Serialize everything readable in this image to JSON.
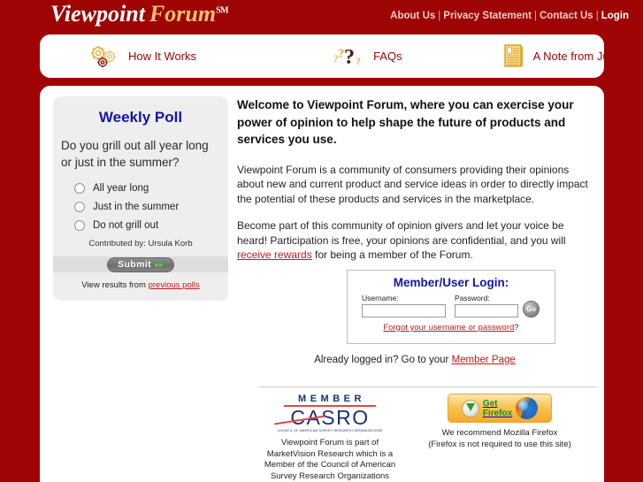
{
  "brand": {
    "name_part1": "Viewpoint",
    "name_part2": "Forum",
    "sm": "SM"
  },
  "topnav": {
    "items": [
      {
        "label": "About Us"
      },
      {
        "label": "Privacy Statement"
      },
      {
        "label": "Contact Us"
      },
      {
        "label": "Login"
      }
    ],
    "separator": "|"
  },
  "navbar": {
    "items": [
      {
        "label": "How It Works",
        "icon": "gears-icon"
      },
      {
        "label": "FAQs",
        "icon": "question-marks-icon"
      },
      {
        "label": "A Note from Julie",
        "icon": "document-icon"
      }
    ]
  },
  "poll": {
    "title": "Weekly Poll",
    "question": "Do you grill out all year long or just in the summer?",
    "options": [
      {
        "label": "All year long"
      },
      {
        "label": "Just in the summer"
      },
      {
        "label": "Do not grill out"
      }
    ],
    "contributed_by": "Contributed by: Ursula Korb",
    "submit_label": "Submit",
    "submit_arrows": "▸▸",
    "results_prefix": "View results from ",
    "results_link": "previous polls"
  },
  "content": {
    "welcome": "Welcome to Viewpoint Forum, where you can exercise your power of opinion to help shape the future of products and services you use.",
    "paragraph1": "Viewpoint Forum is a community of consumers providing their opinions about new and current product and service ideas in order to directly impact the potential of these products and services in the marketplace.",
    "paragraph2_part1": "Become part of this community of opinion givers and let your voice be heard! Participation is free, your opinions are confidential, and you will ",
    "paragraph2_link": "receive rewards",
    "paragraph2_part2": " for being a member of the Forum."
  },
  "login": {
    "title": "Member/User Login:",
    "username_label": "Username:",
    "username_value": "",
    "username_placeholder": "",
    "password_label": "Password:",
    "password_value": "",
    "password_placeholder": "",
    "go_label": "Go",
    "forgot_link": "Forgot your username or password",
    "forgot_suffix": "?"
  },
  "already": {
    "prefix": "Already logged in? Go to your ",
    "link": "Member Page"
  },
  "footer": {
    "casro": {
      "member_word": "MEMBER",
      "name": "CASRO",
      "tiny": "COUNCIL OF AMERICAN SURVEY RESEARCH ORGANIZATIONS",
      "text_line1": "Viewpoint Forum is part of",
      "text_line2": "MarketVision Research which is a",
      "text_line3": "Member of the Council of American",
      "text_line4": "Survey Research Organizations"
    },
    "firefox": {
      "button_line1": "Get",
      "button_line2": "Firefox",
      "text_line1": "We recommend Mozilla Firefox",
      "text_line2": "(Firefox is not required to use this site)"
    }
  },
  "colors": {
    "background_red": "#9e0404",
    "heading_blue": "#1414a8",
    "link_red": "#c01a1a",
    "logo_gold": "#f5c26b"
  }
}
